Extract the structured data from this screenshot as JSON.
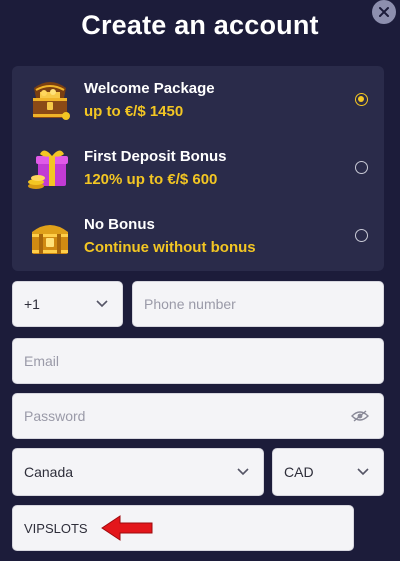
{
  "modal": {
    "title": "Create an account",
    "close_icon": "close-icon"
  },
  "bonuses": [
    {
      "title": "Welcome Package",
      "subtitle": "up to €/$ 1450",
      "icon": "treasure-chest-open-icon",
      "selected": true
    },
    {
      "title": "First Deposit Bonus",
      "subtitle": "120% up to €/$ 600",
      "icon": "gift-box-icon",
      "selected": false
    },
    {
      "title": "No Bonus",
      "subtitle": "Continue without bonus",
      "icon": "treasure-chest-closed-icon",
      "selected": false
    }
  ],
  "form": {
    "phone_code": "+1",
    "phone_placeholder": "Phone number",
    "email_placeholder": "Email",
    "password_placeholder": "Password",
    "country": "Canada",
    "currency": "CAD",
    "promo_code": "VIPSLOTS"
  },
  "colors": {
    "background": "#1c1c3a",
    "panel": "#2a2b4a",
    "accent": "#f3c623",
    "field": "#f4f4f7",
    "annotation_arrow": "#e3161b"
  }
}
